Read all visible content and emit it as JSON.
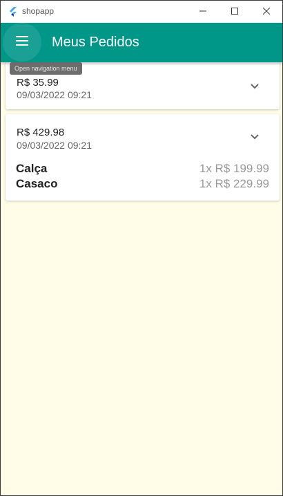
{
  "window": {
    "title": "shopapp"
  },
  "appbar": {
    "title": "Meus Pedidos",
    "menu_icon": "hamburger-menu-icon",
    "tooltip": "Open navigation menu"
  },
  "colors": {
    "primary": "#009688",
    "background": "#fffde7"
  },
  "orders": [
    {
      "total": "R$ 35.99",
      "date": "09/03/2022 09:21",
      "expanded": false,
      "products": []
    },
    {
      "total": "R$ 429.98",
      "date": "09/03/2022 09:21",
      "expanded": true,
      "products": [
        {
          "name": "Calça",
          "qty_price": "1x R$ 199.99"
        },
        {
          "name": "Casaco",
          "qty_price": "1x R$ 229.99"
        }
      ]
    }
  ]
}
